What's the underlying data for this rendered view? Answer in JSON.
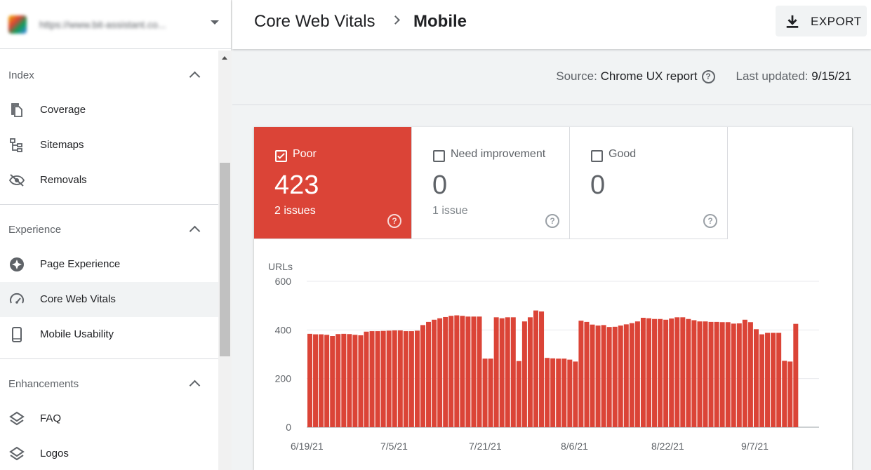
{
  "property": {
    "url": "https://www.bit-assistant.co..."
  },
  "sidebar": {
    "sections": [
      {
        "label": "Index",
        "items": [
          {
            "label": "Coverage"
          },
          {
            "label": "Sitemaps"
          },
          {
            "label": "Removals"
          }
        ]
      },
      {
        "label": "Experience",
        "items": [
          {
            "label": "Page Experience"
          },
          {
            "label": "Core Web Vitals"
          },
          {
            "label": "Mobile Usability"
          }
        ]
      },
      {
        "label": "Enhancements",
        "items": [
          {
            "label": "FAQ"
          },
          {
            "label": "Logos"
          }
        ]
      }
    ]
  },
  "header": {
    "breadcrumb_parent": "Core Web Vitals",
    "breadcrumb_current": "Mobile",
    "export_label": "EXPORT"
  },
  "sourcebar": {
    "source_label": "Source:",
    "source_value": "Chrome UX report",
    "updated_label": "Last updated:",
    "updated_value": "9/15/21"
  },
  "tiles": [
    {
      "label": "Poor",
      "count": "423",
      "issues": "2 issues",
      "checked": true,
      "color": "#db4437"
    },
    {
      "label": "Need improvement",
      "count": "0",
      "issues": "1 issue",
      "checked": false
    },
    {
      "label": "Good",
      "count": "0",
      "issues": "",
      "checked": false
    }
  ],
  "colors": {
    "poor": "#db4437",
    "accent_text": "#202124"
  },
  "chart_data": {
    "type": "bar",
    "ylabel": "URLs",
    "ylim": [
      0,
      600
    ],
    "yticks": [
      0,
      200,
      400,
      600
    ],
    "xtick_labels": [
      "6/19/21",
      "7/5/21",
      "7/21/21",
      "8/6/21",
      "8/22/21",
      "9/7/21"
    ],
    "grid": true,
    "series": [
      {
        "color": "#db4437",
        "values": [
          384,
          382,
          382,
          380,
          375,
          383,
          384,
          383,
          380,
          378,
          393,
          395,
          395,
          396,
          397,
          398,
          398,
          395,
          395,
          397,
          420,
          433,
          442,
          448,
          453,
          458,
          460,
          458,
          455,
          455,
          455,
          282,
          282,
          452,
          448,
          452,
          452,
          272,
          435,
          452,
          480,
          476,
          285,
          283,
          282,
          282,
          278,
          270,
          438,
          433,
          422,
          418,
          420,
          412,
          413,
          418,
          423,
          428,
          435,
          450,
          448,
          445,
          445,
          442,
          447,
          452,
          452,
          445,
          440,
          435,
          435,
          433,
          433,
          432,
          432,
          426,
          427,
          442,
          432,
          403,
          382,
          388,
          388,
          388,
          273,
          270,
          425
        ]
      }
    ]
  }
}
